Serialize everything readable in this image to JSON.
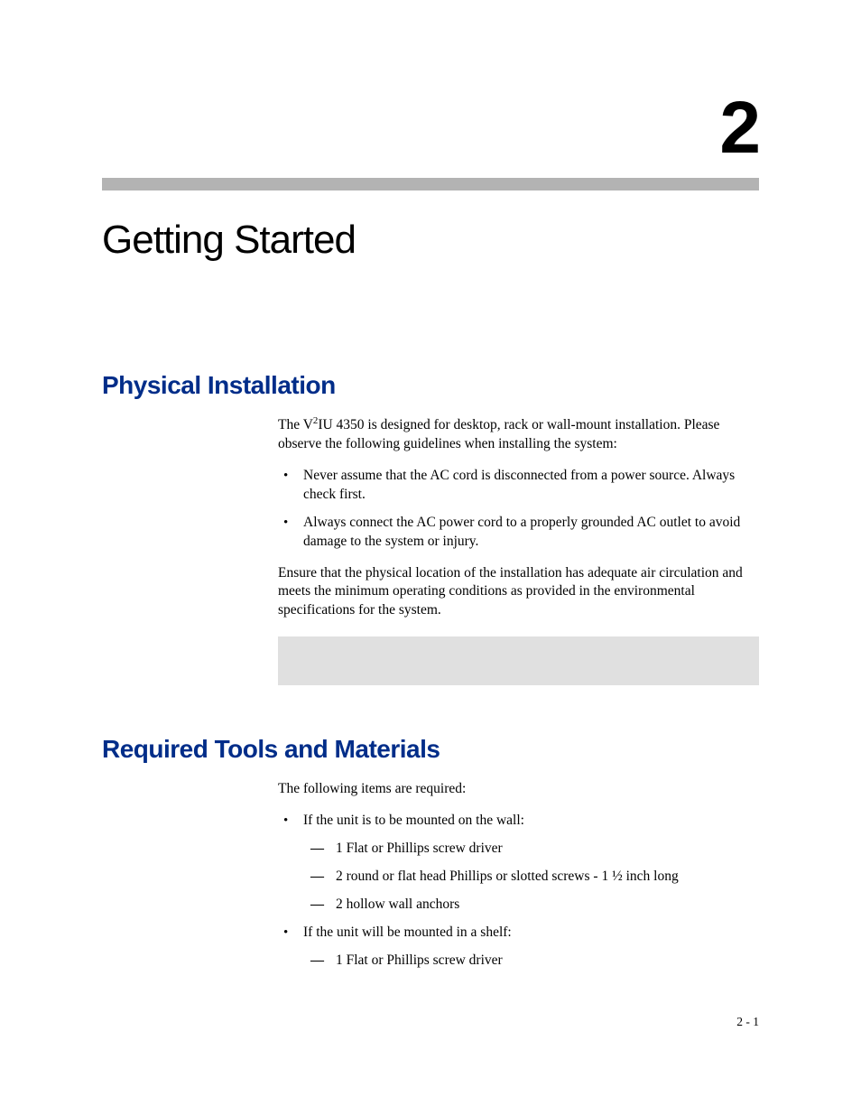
{
  "chapter": {
    "number": "2",
    "title": "Getting Started"
  },
  "sections": {
    "physical": {
      "heading": "Physical Installation",
      "intro_pre": "The V",
      "intro_sup": "2",
      "intro_post": "IU 4350 is designed for desktop, rack or wall-mount installation. Please observe the following guidelines when installing the system:",
      "bullets": [
        "Never assume that the AC cord is disconnected from a power source. Always check first.",
        "Always connect the AC power cord to a properly grounded AC outlet to avoid damage to the system or injury."
      ],
      "closing": "Ensure that the physical location of the installation has adequate air circulation and meets the minimum operating conditions as provided in the environmental specifications for the system."
    },
    "tools": {
      "heading": "Required Tools and Materials",
      "intro": "The following items are required:",
      "item1": {
        "label": "If the unit is to be mounted on the wall:",
        "sub": [
          "1 Flat or Phillips screw driver",
          "2 round or flat head Phillips or slotted screws - 1 ½ inch long",
          "2 hollow wall anchors"
        ]
      },
      "item2": {
        "label": "If the unit will be mounted in a shelf:",
        "sub": [
          "1 Flat or Phillips screw driver"
        ]
      }
    }
  },
  "footer": {
    "page_number": "2 - 1"
  }
}
